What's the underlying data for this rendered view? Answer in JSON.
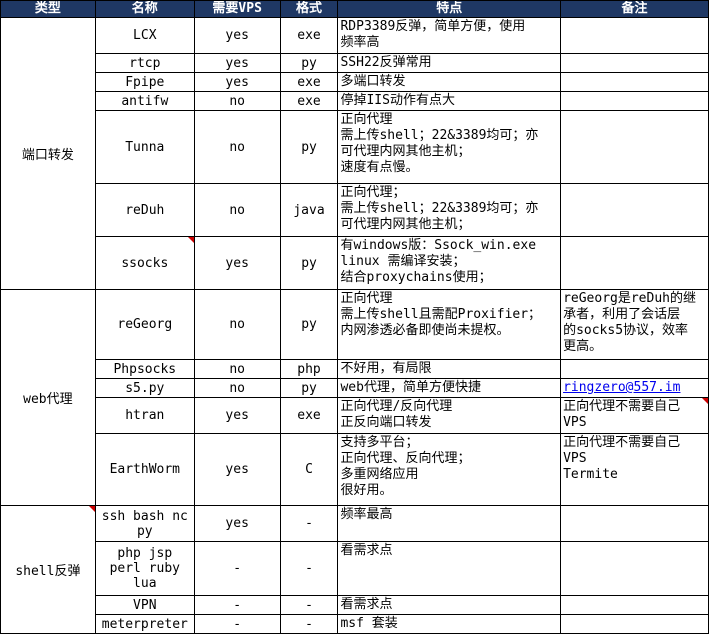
{
  "headers": {
    "type": "类型",
    "name": "名称",
    "vps": "需要VPS",
    "format": "格式",
    "features": "特点",
    "notes": "备注"
  },
  "categories": {
    "port": "端口转发",
    "web": "web代理",
    "shell": "shell反弹"
  },
  "rows": [
    {
      "name": "LCX",
      "vps": "yes",
      "format": "exe",
      "features": "RDP3389反弹，简单方便，使用\n频率高",
      "notes": ""
    },
    {
      "name": "rtcp",
      "vps": "yes",
      "format": "py",
      "features": "SSH22反弹常用",
      "notes": ""
    },
    {
      "name": "Fpipe",
      "vps": "yes",
      "format": "exe",
      "features": "多端口转发",
      "notes": ""
    },
    {
      "name": "antifw",
      "vps": "no",
      "format": "exe",
      "features": "停掉IIS动作有点大",
      "notes": ""
    },
    {
      "name": "Tunna",
      "vps": "no",
      "format": "py",
      "features": "正向代理\n需上传shell；22&3389均可；亦\n可代理内网其他主机；\n速度有点慢。",
      "notes": ""
    },
    {
      "name": "reDuh",
      "vps": "no",
      "format": "java",
      "features": "正向代理；\n需上传shell；22&3389均可；亦\n可代理内网其他主机；",
      "notes": ""
    },
    {
      "name": "ssocks",
      "vps": "yes",
      "format": "py",
      "features": "有windows版：Ssock_win.exe\nlinux 需编译安装；\n结合proxychains使用；",
      "notes": ""
    },
    {
      "name": "reGeorg",
      "vps": "no",
      "format": "py",
      "features": "正向代理\n需上传shell且需配Proxifier；\n内网渗透必备即使尚未提权。",
      "notes": "reGeorg是reDuh的继\n承者，利用了会话层\n的socks5协议，效率\n更高。"
    },
    {
      "name": "Phpsocks",
      "vps": "no",
      "format": "php",
      "features": "不好用，有局限",
      "notes": ""
    },
    {
      "name": "s5.py",
      "vps": "no",
      "format": "py",
      "features": "web代理，简单方便快捷",
      "notes": "ringzero@557.im"
    },
    {
      "name": "htran",
      "vps": "yes",
      "format": "exe",
      "features": "正向代理/反向代理\n正反向端口转发",
      "notes": "正向代理不需要自己\nVPS"
    },
    {
      "name": "EarthWorm",
      "vps": "yes",
      "format": "C",
      "features": "支持多平台；\n正向代理、反向代理；\n多重网络应用\n很好用。",
      "notes": "正向代理不需要自己\nVPS\nTermite"
    },
    {
      "name": "ssh bash nc\npy",
      "vps": "yes",
      "format": "-",
      "features": "频率最高",
      "notes": ""
    },
    {
      "name": "php jsp\nperl ruby\nlua",
      "vps": "-",
      "format": "-",
      "features": "看需求点",
      "notes": ""
    },
    {
      "name": "VPN",
      "vps": "-",
      "format": "-",
      "features": "看需求点",
      "notes": ""
    },
    {
      "name": "meterpreter",
      "vps": "-",
      "format": "-",
      "features": "msf 套装",
      "notes": ""
    }
  ]
}
